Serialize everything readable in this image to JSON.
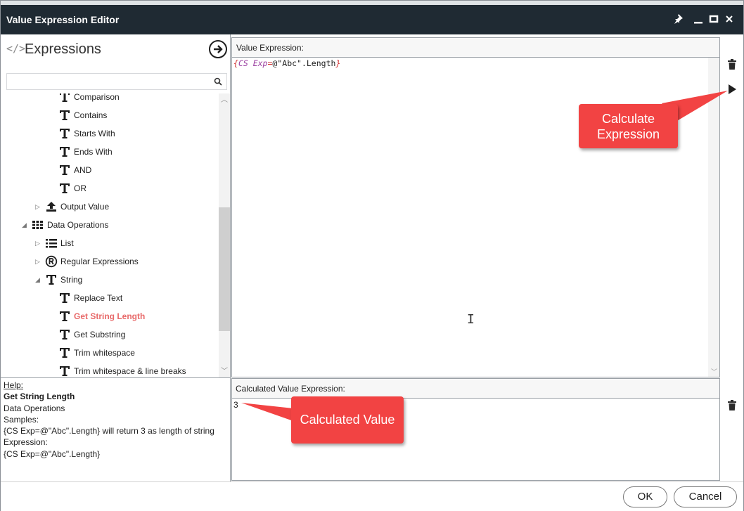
{
  "window": {
    "title": "Value Expression Editor"
  },
  "left_panel": {
    "title": "Expressions",
    "search_placeholder": "",
    "tree": [
      {
        "label": "Comparison",
        "icon": "text-icon",
        "expander": "none"
      },
      {
        "label": "Contains",
        "icon": "text-icon",
        "expander": "none"
      },
      {
        "label": "Starts With",
        "icon": "text-icon",
        "expander": "none"
      },
      {
        "label": "Ends With",
        "icon": "text-icon",
        "expander": "none"
      },
      {
        "label": "AND",
        "icon": "text-icon",
        "expander": "none"
      },
      {
        "label": "OR",
        "icon": "text-icon",
        "expander": "none"
      },
      {
        "label": "Output Value",
        "icon": "upload-icon",
        "expander": "collapsed"
      },
      {
        "label": "Data Operations",
        "icon": "grid-icon",
        "expander": "expanded"
      },
      {
        "label": "List",
        "icon": "list-icon",
        "expander": "collapsed"
      },
      {
        "label": "Regular Expressions",
        "icon": "registered-icon",
        "expander": "collapsed"
      },
      {
        "label": "String",
        "icon": "text-icon",
        "expander": "expanded"
      },
      {
        "label": "Replace Text",
        "icon": "text-icon",
        "expander": "none"
      },
      {
        "label": "Get String Length",
        "icon": "text-icon",
        "expander": "none",
        "selected": true
      },
      {
        "label": "Get Substring",
        "icon": "text-icon",
        "expander": "none"
      },
      {
        "label": "Trim whitespace",
        "icon": "text-icon",
        "expander": "none"
      },
      {
        "label": "Trim whitespace & line breaks",
        "icon": "text-icon",
        "expander": "none"
      }
    ]
  },
  "help": {
    "heading": "Help:",
    "title": "Get String Length",
    "category": "Data Operations",
    "samples_label": "Samples:",
    "sample": "{CS Exp=@\"Abc\".Length} will return 3 as length of string",
    "expression_label": "Expression:",
    "expression": "{CS Exp=@\"Abc\".Length}"
  },
  "editor": {
    "label": "Value Expression:",
    "tokens": {
      "open": "{",
      "kw": "CS Exp",
      "eq": "=",
      "str": "@\"Abc\".Length",
      "close": "}"
    }
  },
  "result": {
    "label": "Calculated Value Expression:",
    "value": "3"
  },
  "callouts": {
    "calculate_line1": "Calculate",
    "calculate_line2": "Expression",
    "calculated_value": "Calculated Value"
  },
  "buttons": {
    "ok": "OK",
    "cancel": "Cancel"
  },
  "colors": {
    "titlebar": "#1f2a33",
    "callout": "#f24343",
    "selected_item": "#e86a6a",
    "code_keyword": "#9a3da0",
    "code_brace": "#d12d2d"
  }
}
